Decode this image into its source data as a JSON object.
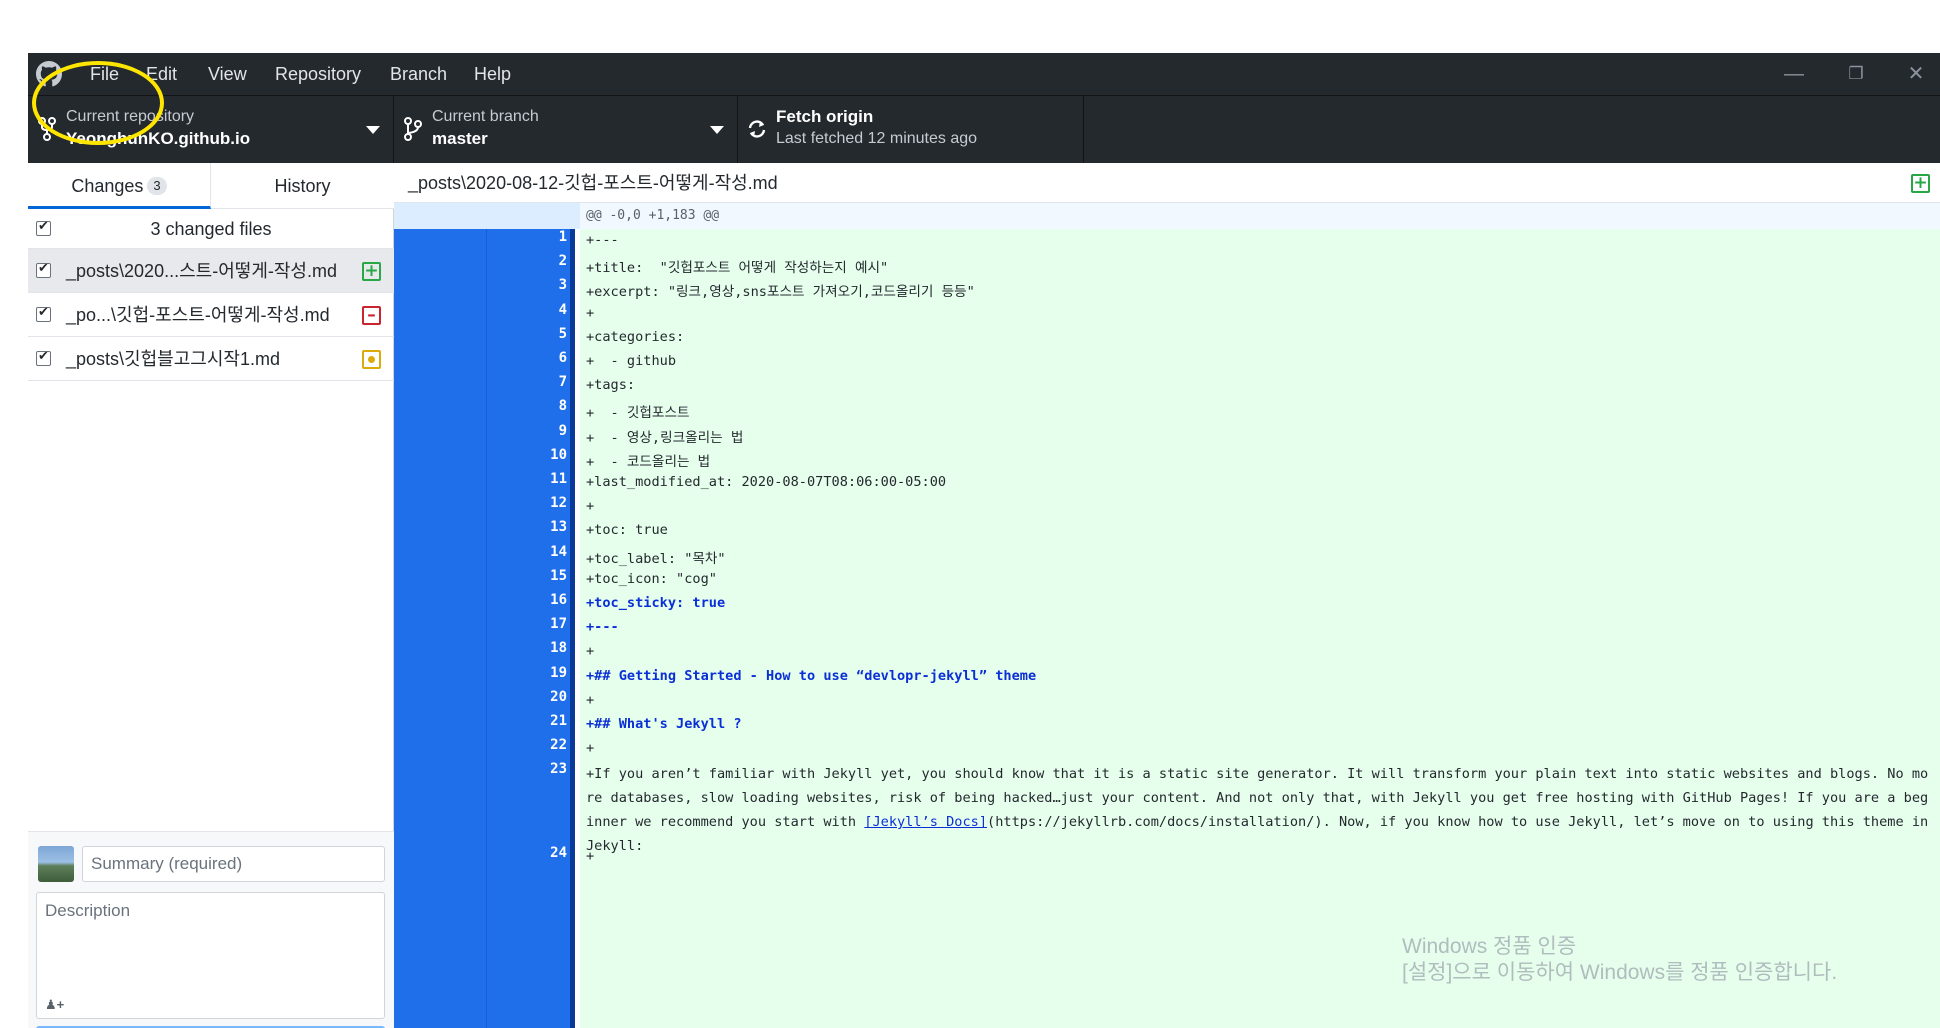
{
  "colors": {
    "accent": "#0366d6",
    "gutter": "#1f6feb",
    "added_bg": "#e6ffed",
    "highlight": "#ffe600"
  },
  "menu": {
    "items": [
      "File",
      "Edit",
      "View",
      "Repository",
      "Branch",
      "Help"
    ]
  },
  "toolbar": {
    "repo_label": "Current repository",
    "repo_name": "YeonghunKO.github.io",
    "branch_label": "Current branch",
    "branch_name": "master",
    "fetch_label": "Fetch origin",
    "fetch_status": "Last fetched 12 minutes ago"
  },
  "sidebar": {
    "tab_changes": "Changes",
    "changes_count": "3",
    "tab_history": "History",
    "changed_files_label": "3 changed files",
    "files": [
      {
        "name": "_posts\\2020...스트-어떻게-작성.md",
        "status": "added"
      },
      {
        "name": "_po...\\깃헙-포스트-어떻게-작성.md",
        "status": "removed"
      },
      {
        "name": "_posts\\깃헙블고그시작1.md",
        "status": "modified"
      }
    ],
    "summary_placeholder": "Summary (required)",
    "description_placeholder": "Description"
  },
  "diff": {
    "file_path": "_posts\\2020-08-12-깃헙-포스트-어떻게-작성.md",
    "hunk_header": "@@ -0,0 +1,183 @@",
    "lines": [
      {
        "n": "1",
        "text": "+---"
      },
      {
        "n": "2",
        "text": "+title:  \"깃헙포스트 어떻게 작성하는지 예시\""
      },
      {
        "n": "3",
        "text": "+excerpt: \"링크,영상,sns포스트 가져오기,코드올리기 등등\""
      },
      {
        "n": "4",
        "text": "+"
      },
      {
        "n": "5",
        "text": "+categories:"
      },
      {
        "n": "6",
        "text": "+  - github"
      },
      {
        "n": "7",
        "text": "+tags:"
      },
      {
        "n": "8",
        "text": "+  - 깃헙포스트"
      },
      {
        "n": "9",
        "text": "+  - 영상,링크올리는 법"
      },
      {
        "n": "10",
        "text": "+  - 코드올리는 법"
      },
      {
        "n": "11",
        "text": "+last_modified_at: 2020-08-07T08:06:00-05:00"
      },
      {
        "n": "12",
        "text": "+"
      },
      {
        "n": "13",
        "text": "+toc: true"
      },
      {
        "n": "14",
        "text": "+toc_label: \"목차\""
      },
      {
        "n": "15",
        "text": "+toc_icon: \"cog\""
      },
      {
        "n": "16",
        "text": "+toc_sticky: true"
      },
      {
        "n": "17",
        "text": "+---"
      },
      {
        "n": "18",
        "text": "+"
      },
      {
        "n": "19",
        "text": "+## Getting Started - How to use “devlopr-jekyll” theme"
      },
      {
        "n": "20",
        "text": "+"
      },
      {
        "n": "21",
        "text": "+## What's Jekyll ?"
      },
      {
        "n": "22",
        "text": "+"
      }
    ],
    "line23": {
      "n": "23",
      "before": "+If you aren’t familiar with Jekyll yet, you should know that it is a static site generator. It will transform your plain text into static websites and blogs. No more databases, slow loading websites, risk of being hacked…just your content. And not only that, with Jekyll you get free hosting with GitHub Pages! If you are a beginner we recommend you start with ",
      "link": "[Jekyll’s Docs]",
      "after": "(https://jekyllrb.com/docs/installation/). Now, if you know how to use Jekyll, let’s move on to using this theme in Jekyll:"
    },
    "line24": {
      "n": "24",
      "text": "+"
    }
  },
  "watermark": {
    "line1": "Windows 정품 인증",
    "line2": "[설정]으로 이동하여 Windows를 정품 인증합니다."
  }
}
